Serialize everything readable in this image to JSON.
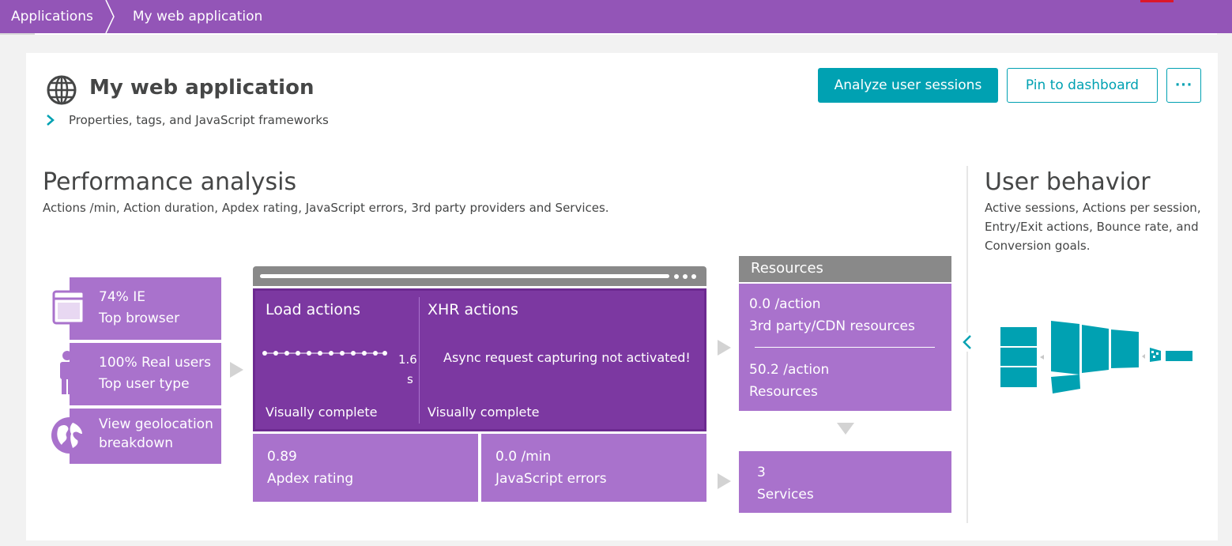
{
  "breadcrumb": {
    "root": "Applications",
    "current": "My web application"
  },
  "header": {
    "title": "My web application",
    "properties_link": "Properties, tags, and JavaScript frameworks",
    "analyze_button": "Analyze user sessions",
    "pin_button": "Pin to dashboard",
    "more_button": "···"
  },
  "performance": {
    "title": "Performance analysis",
    "description": "Actions /min, Action duration, Apdex rating, JavaScript errors, 3rd party providers and Services.",
    "browser": {
      "value": "74% IE",
      "label": "Top browser"
    },
    "user_type": {
      "value": "100% Real users",
      "label": "Top user type"
    },
    "geolocation": {
      "label": "View geolocation breakdown"
    },
    "load_actions": {
      "title": "Load actions",
      "value": "1.6",
      "unit": "s",
      "footer": "Visually complete"
    },
    "xhr_actions": {
      "title": "XHR actions",
      "message": "Async request capturing not activated!",
      "footer": "Visually complete"
    },
    "apdex": {
      "value": "0.89",
      "label": "Apdex rating"
    },
    "js_errors": {
      "value": "0.0 /min",
      "label": "JavaScript errors"
    },
    "resources": {
      "title": "Resources",
      "third_party_value": "0.0 /action",
      "third_party_label": "3rd party/CDN resources",
      "resources_value": "50.2 /action",
      "resources_label": "Resources"
    },
    "services": {
      "value": "3",
      "label": "Services"
    }
  },
  "user_behavior": {
    "title": "User behavior",
    "description": "Active sessions, Actions per session, Entry/Exit actions, Bounce rate, and Conversion goals."
  },
  "colors": {
    "topbar": "#9355b7",
    "tile": "#a972cc",
    "tile_dark": "#7c38a1",
    "accent": "#00a1b2",
    "neutral_header": "#898989"
  }
}
